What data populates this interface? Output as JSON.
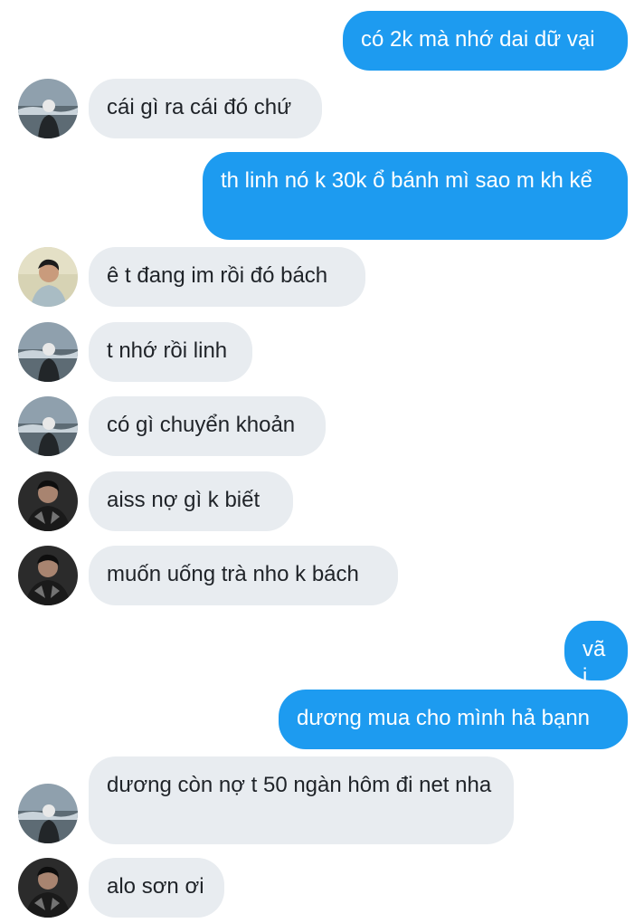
{
  "messages": [
    {
      "side": "out",
      "text": "có 2k mà nhớ dai dữ vại"
    },
    {
      "side": "in",
      "avatar": "sea-photo-avatar",
      "text": "cái gì ra cái đó chứ"
    },
    {
      "side": "out",
      "text": "th linh nó k 30k ổ bánh mì sao m kh kể"
    },
    {
      "side": "in",
      "avatar": "portrait-avatar",
      "text": "ê t đang im rồi đó bách"
    },
    {
      "side": "in",
      "avatar": "sea-photo-avatar",
      "text": "t nhớ rồi linh"
    },
    {
      "side": "in",
      "avatar": "sea-photo-avatar",
      "text": "có gì chuyển khoản"
    },
    {
      "side": "in",
      "avatar": "dark-jacket-avatar",
      "text": "aiss nợ gì k biết"
    },
    {
      "side": "in",
      "avatar": "dark-jacket-avatar",
      "text": "muốn uống trà nho k bách"
    },
    {
      "side": "out",
      "text": "vãi"
    },
    {
      "side": "out",
      "text": "dương mua cho mình hả bạnn"
    },
    {
      "side": "in",
      "avatar": "sea-photo-avatar",
      "text": "dương còn nợ t 50 ngàn hôm đi net nha"
    },
    {
      "side": "in",
      "avatar": "dark-jacket-avatar",
      "text": "alo sơn ơi"
    }
  ],
  "colors": {
    "outgoing_bubble": "#1d9bf0",
    "outgoing_text": "#ffffff",
    "incoming_bubble": "#e8ecf0",
    "incoming_text": "#1f2328"
  }
}
